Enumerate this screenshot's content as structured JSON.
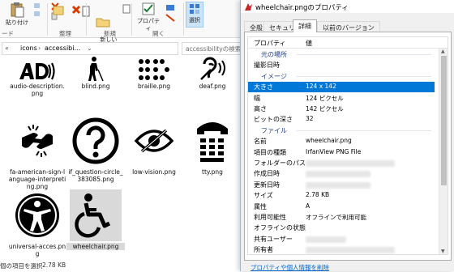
{
  "explorer": {
    "ribbon": {
      "paste_label": "貼り付け",
      "new_folder_label": "新しい\nフォルダー",
      "properties_label": "プロパティ",
      "select_label": "選択",
      "group_clipboard": "ード",
      "group_organize": "整理",
      "group_new": "新規",
      "group_open": "開く"
    },
    "address": {
      "path_root": "icons",
      "path_sub": "accessibi...",
      "search_placeholder": "accessibilityの検索"
    },
    "files": [
      {
        "name": "audio-description.png",
        "icon": "audio-description-icon"
      },
      {
        "name": "blind.png",
        "icon": "blind-person-icon"
      },
      {
        "name": "braille.png",
        "icon": "braille-icon"
      },
      {
        "name": "deaf.png",
        "icon": "deaf-ear-icon"
      },
      {
        "name": "fa-american-sign-language-interpreting.png",
        "icon": "sign-language-icon"
      },
      {
        "name": "if_question-circle_383085.png",
        "icon": "question-circle-icon"
      },
      {
        "name": "low-vision.png",
        "icon": "low-vision-eye-icon"
      },
      {
        "name": "tty.png",
        "icon": "tty-phone-icon"
      },
      {
        "name": "universal-acces.png",
        "icon": "universal-access-icon"
      },
      {
        "name": "wheelchair.png",
        "icon": "wheelchair-icon"
      }
    ],
    "status": {
      "selected_text": "個の項目を選択",
      "size": "2.78 KB"
    }
  },
  "dialog": {
    "title": "wheelchair.pngのプロパティ",
    "tabs": [
      "全般",
      "セキュリティ",
      "詳細",
      "以前のバージョン"
    ],
    "active_tab": "詳細",
    "header": {
      "property": "プロパティ",
      "value": "値"
    },
    "rows": [
      {
        "k": "元の場所",
        "v": "",
        "type": "section"
      },
      {
        "k": "撮影日時",
        "v": ""
      },
      {
        "k": "イメージ",
        "v": "",
        "type": "section"
      },
      {
        "k": "大きさ",
        "v": "124 x 142",
        "type": "selected"
      },
      {
        "k": "幅",
        "v": "124 ピクセル"
      },
      {
        "k": "高さ",
        "v": "142 ピクセル"
      },
      {
        "k": "ビットの深さ",
        "v": "32"
      },
      {
        "k": "ファイル",
        "v": "",
        "type": "section"
      },
      {
        "k": "名前",
        "v": "wheelchair.png"
      },
      {
        "k": "項目の種類",
        "v": "IrfanView PNG File"
      },
      {
        "k": "フォルダーのパス",
        "v": "",
        "blur": 110
      },
      {
        "k": "作成日時",
        "v": "",
        "blur": 80
      },
      {
        "k": "更新日時",
        "v": "",
        "blur": 80
      },
      {
        "k": "サイズ",
        "v": "2.78 KB"
      },
      {
        "k": "属性",
        "v": "A"
      },
      {
        "k": "利用可能性",
        "v": "オフラインで利用可能"
      },
      {
        "k": "オフラインの状態",
        "v": ""
      },
      {
        "k": "共有ユーザー",
        "v": "",
        "blur": 50
      },
      {
        "k": "所有者",
        "v": "",
        "blur": 110
      }
    ],
    "link": "プロパティや個人情報を削除"
  }
}
